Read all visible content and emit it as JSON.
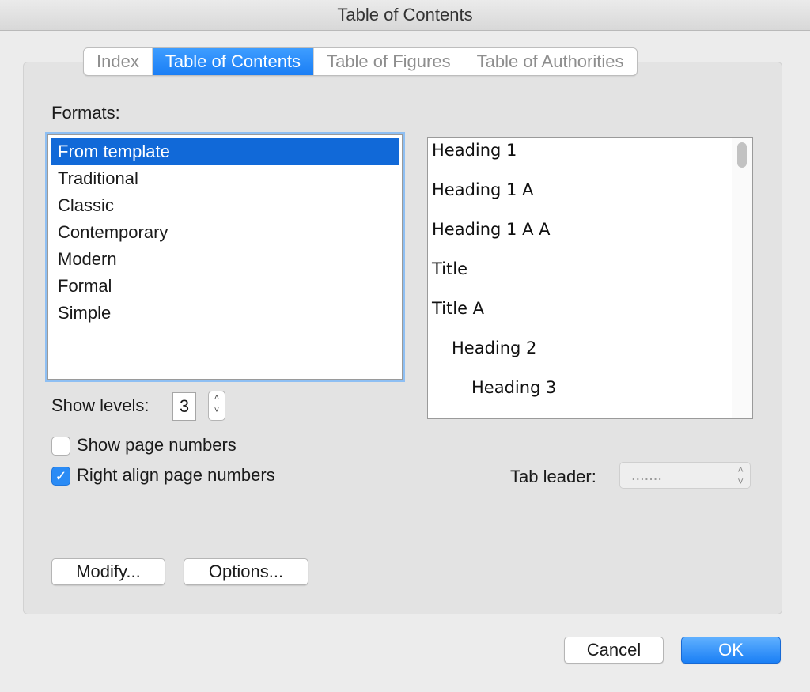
{
  "window": {
    "title": "Table of Contents"
  },
  "tabs": [
    {
      "label": "Index"
    },
    {
      "label": "Table of Contents",
      "active": true
    },
    {
      "label": "Table of Figures"
    },
    {
      "label": "Table of Authorities"
    }
  ],
  "formats": {
    "label": "Formats:",
    "items": [
      "From template",
      "Traditional",
      "Classic",
      "Contemporary",
      "Modern",
      "Formal",
      "Simple"
    ],
    "selected": "From template"
  },
  "preview": {
    "lines": [
      "Heading 1",
      "Heading 1 A",
      "Heading 1 A A",
      "Title",
      "Title A",
      "Heading 2",
      "Heading 3"
    ]
  },
  "show_levels": {
    "label": "Show levels:",
    "value": "3"
  },
  "options": {
    "show_page_numbers": {
      "label": "Show page numbers",
      "checked": false
    },
    "right_align_page_numbers": {
      "label": "Right align page numbers",
      "checked": true
    }
  },
  "tab_leader": {
    "label": "Tab leader:",
    "value": "......."
  },
  "buttons": {
    "modify": "Modify...",
    "options": "Options...",
    "cancel": "Cancel",
    "ok": "OK"
  },
  "colors": {
    "accent": "#1a7ef5",
    "selection": "#1169d8"
  }
}
